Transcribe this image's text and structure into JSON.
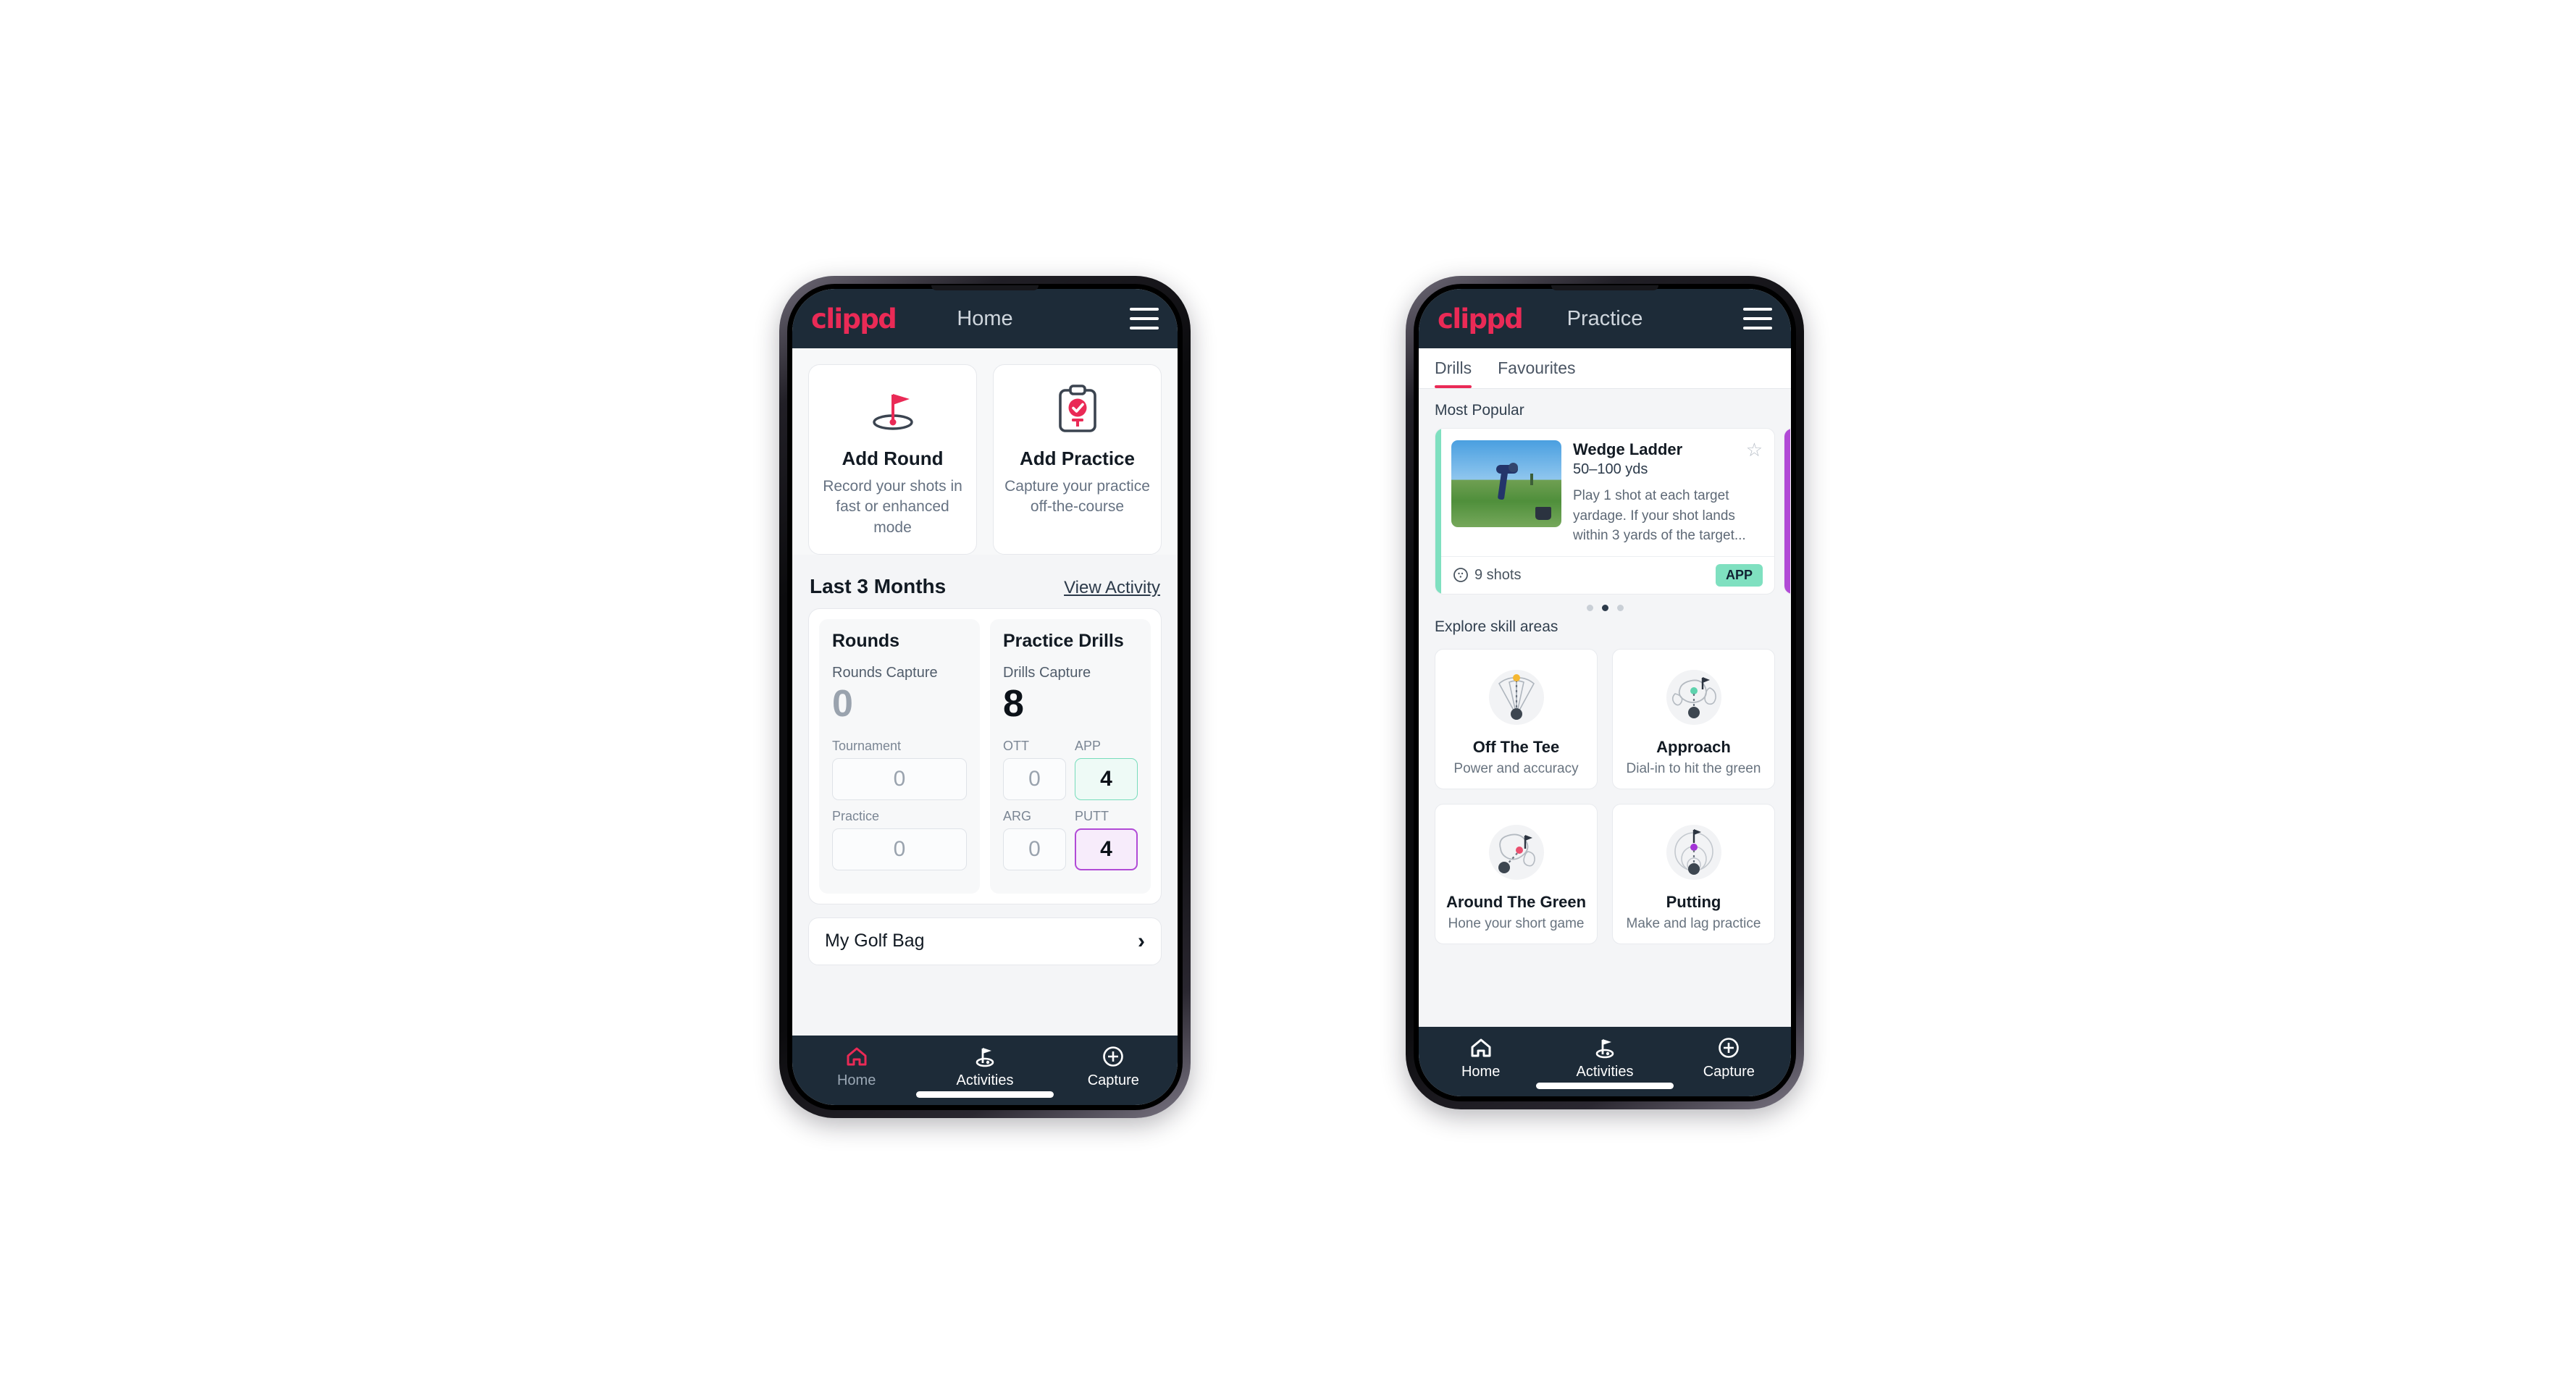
{
  "colors": {
    "brand_pink": "#ea2a56",
    "appbar_navy": "#1d2b38",
    "accent_green": "#7fe0c0",
    "accent_purple": "#b14ad6",
    "page_bg": "#f4f5f7"
  },
  "phone1": {
    "appbar": {
      "logo": "clippd",
      "title": "Home",
      "menu_icon": "hamburger-menu-icon"
    },
    "actions": [
      {
        "icon": "golf-flag-hole-icon",
        "title": "Add Round",
        "subtitle": "Record your shots in fast or enhanced mode"
      },
      {
        "icon": "clipboard-check-icon",
        "title": "Add Practice",
        "subtitle": "Capture your practice off-the-course"
      }
    ],
    "section": {
      "title": "Last 3 Months",
      "link": "View Activity"
    },
    "rounds": {
      "heading": "Rounds",
      "capture_label": "Rounds Capture",
      "capture_value": "0",
      "fields": [
        {
          "label": "Tournament",
          "value": "0",
          "state": "default"
        },
        {
          "label": "Practice",
          "value": "0",
          "state": "default"
        }
      ]
    },
    "drills": {
      "heading": "Practice Drills",
      "capture_label": "Drills Capture",
      "capture_value": "8",
      "fields": [
        {
          "label": "OTT",
          "value": "0",
          "state": "default"
        },
        {
          "label": "APP",
          "value": "4",
          "state": "green"
        },
        {
          "label": "ARG",
          "value": "0",
          "state": "default"
        },
        {
          "label": "PUTT",
          "value": "4",
          "state": "purple"
        }
      ]
    },
    "golf_bag": {
      "label": "My Golf Bag",
      "chevron": "chevron-right-icon"
    },
    "bottom_nav": [
      {
        "icon": "home-icon",
        "label": "Home",
        "active": true
      },
      {
        "icon": "golf-flag-icon",
        "label": "Activities",
        "active": false
      },
      {
        "icon": "plus-circle-icon",
        "label": "Capture",
        "active": false
      }
    ]
  },
  "phone2": {
    "appbar": {
      "logo": "clippd",
      "title": "Practice",
      "menu_icon": "hamburger-menu-icon"
    },
    "tabs": [
      {
        "label": "Drills",
        "active": true
      },
      {
        "label": "Favourites",
        "active": false
      }
    ],
    "most_popular_label": "Most Popular",
    "drill_card": {
      "accent_color": "#7fe0c0",
      "thumbnail": "golfer-practice-photo",
      "name": "Wedge Ladder",
      "yardage": "50–100 yds",
      "description": "Play 1 shot at each target yardage. If your shot lands within 3 yards of the target...",
      "favourite_icon": "star-outline-icon",
      "shots_icon": "golf-ball-icon",
      "shots": "9 shots",
      "tag": "APP"
    },
    "next_card_accent": "#b14ad6",
    "carousel_dots": {
      "count": 3,
      "active_index": 1
    },
    "explore_label": "Explore skill areas",
    "skills": [
      {
        "icon": "off-the-tee-icon",
        "title": "Off The Tee",
        "subtitle": "Power and accuracy"
      },
      {
        "icon": "approach-icon",
        "title": "Approach",
        "subtitle": "Dial-in to hit the green"
      },
      {
        "icon": "around-the-green-icon",
        "title": "Around The Green",
        "subtitle": "Hone your short game"
      },
      {
        "icon": "putting-icon",
        "title": "Putting",
        "subtitle": "Make and lag practice"
      }
    ],
    "bottom_nav": [
      {
        "icon": "home-icon",
        "label": "Home",
        "active": false
      },
      {
        "icon": "golf-flag-icon",
        "label": "Activities",
        "active": true
      },
      {
        "icon": "plus-circle-icon",
        "label": "Capture",
        "active": false
      }
    ]
  }
}
